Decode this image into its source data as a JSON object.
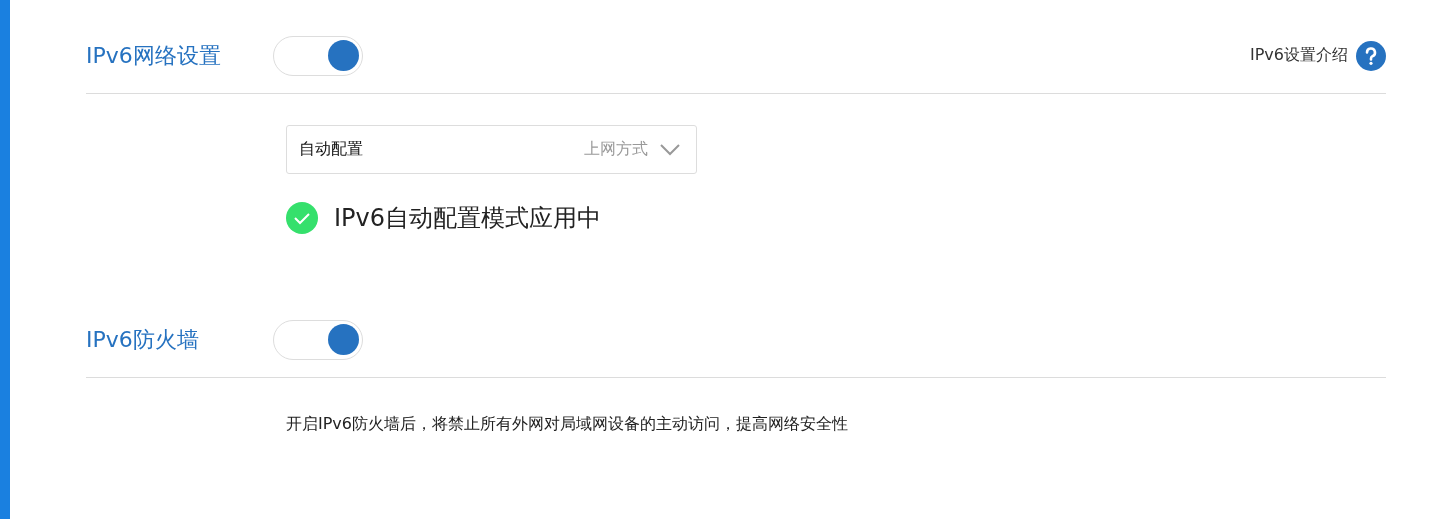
{
  "ipv6_settings": {
    "title": "IPv6网络设置",
    "on": true,
    "help_link": "IPv6设置介绍",
    "connection_select": {
      "value": "自动配置",
      "label": "上网方式"
    },
    "status": {
      "text": "IPv6自动配置模式应用中",
      "ok": true
    }
  },
  "ipv6_firewall": {
    "title": "IPv6防火墙",
    "on": true,
    "description": "开启IPv6防火墙后，将禁止所有外网对局域网设备的主动访问，提高网络安全性"
  }
}
